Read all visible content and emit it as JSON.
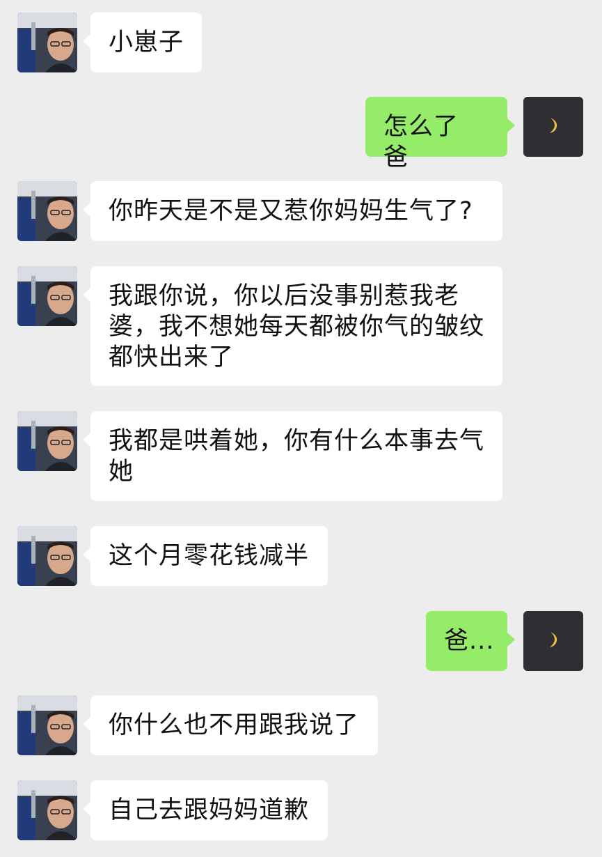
{
  "colors": {
    "background": "#ededed",
    "incoming_bubble": "#ffffff",
    "outgoing_bubble": "#95ec69",
    "text": "#111111"
  },
  "avatars": {
    "father": "father-profile-photo",
    "me": "crescent-moon-icon"
  },
  "messages": [
    {
      "sender": "father",
      "text": "小崽子"
    },
    {
      "sender": "me",
      "text": "怎么了 爸"
    },
    {
      "sender": "father",
      "text": "你昨天是不是又惹你妈妈生气了?"
    },
    {
      "sender": "father",
      "text": "我跟你说，你以后没事别惹我老婆，我不想她每天都被你气的皱纹都快出来了"
    },
    {
      "sender": "father",
      "text": "我都是哄着她，你有什么本事去气她"
    },
    {
      "sender": "father",
      "text": "这个月零花钱减半"
    },
    {
      "sender": "me",
      "text": "爸..."
    },
    {
      "sender": "father",
      "text": "你什么也不用跟我说了"
    },
    {
      "sender": "father",
      "text": "自己去跟妈妈道歉"
    }
  ]
}
